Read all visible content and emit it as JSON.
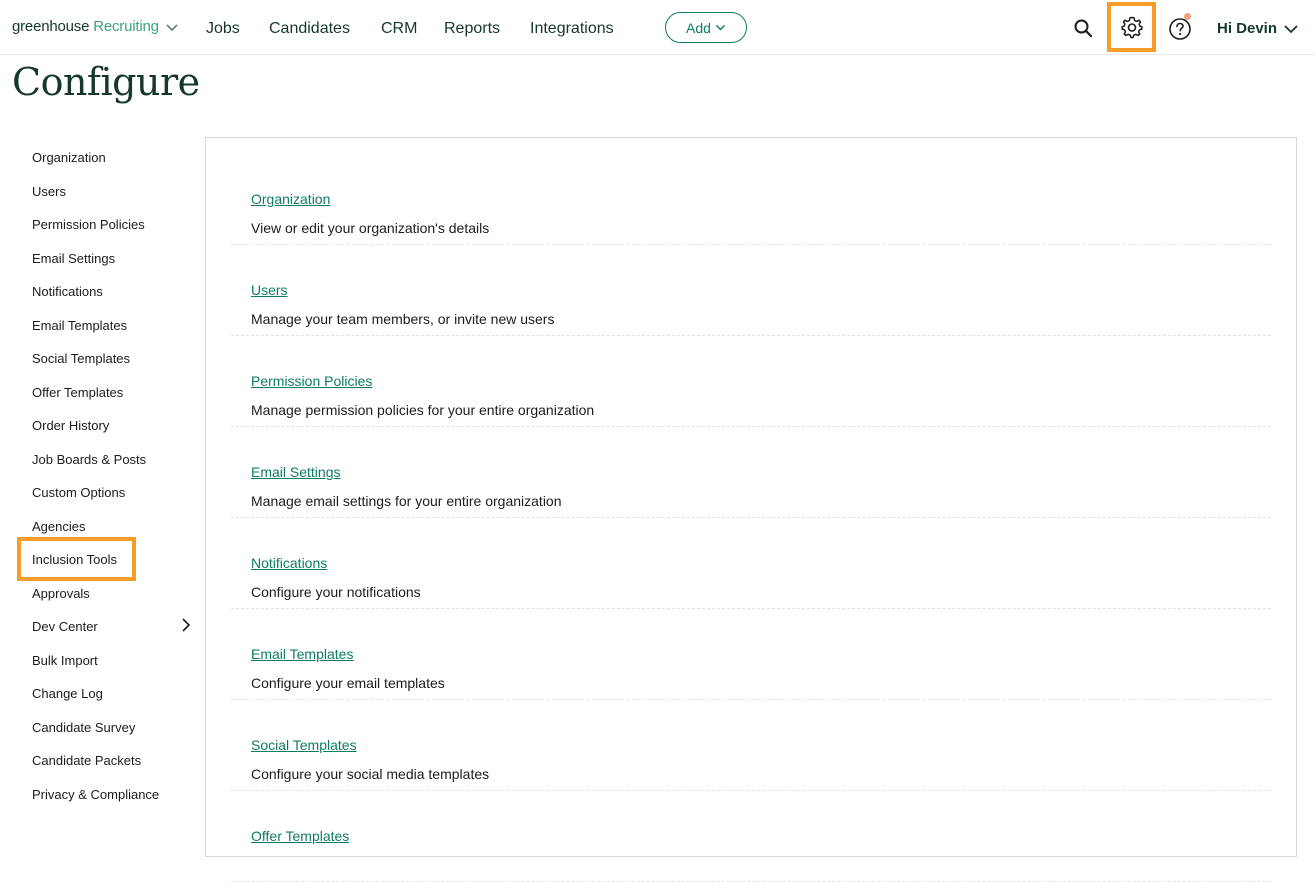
{
  "header": {
    "logo_brand": "greenhouse",
    "logo_product": "Recruiting",
    "nav": [
      "Jobs",
      "Candidates",
      "CRM",
      "Reports",
      "Integrations"
    ],
    "add_label": "Add",
    "user_greeting": "Hi Devin"
  },
  "page": {
    "title": "Configure"
  },
  "sidebar": {
    "items": [
      "Organization",
      "Users",
      "Permission Policies",
      "Email Settings",
      "Notifications",
      "Email Templates",
      "Social Templates",
      "Offer Templates",
      "Order History",
      "Job Boards & Posts",
      "Custom Options",
      "Agencies",
      "Inclusion Tools",
      "Approvals",
      "Dev Center",
      "Bulk Import",
      "Change Log",
      "Candidate Survey",
      "Candidate Packets",
      "Privacy & Compliance"
    ],
    "highlighted": "Inclusion Tools"
  },
  "main": {
    "rows": [
      {
        "title": "Organization",
        "desc": "View or edit your organization's details"
      },
      {
        "title": "Users",
        "desc": "Manage your team members, or invite new users"
      },
      {
        "title": "Permission Policies",
        "desc": "Manage permission policies for your entire organization"
      },
      {
        "title": "Email Settings",
        "desc": "Manage email settings for your entire organization"
      },
      {
        "title": "Notifications",
        "desc": "Configure your notifications"
      },
      {
        "title": "Email Templates",
        "desc": "Configure your email templates"
      },
      {
        "title": "Social Templates",
        "desc": "Configure your social media templates"
      },
      {
        "title": "Offer Templates",
        "desc": ""
      }
    ]
  },
  "colors": {
    "accent": "#0e7c61",
    "highlight": "#f79d2a",
    "title": "#15372c"
  }
}
